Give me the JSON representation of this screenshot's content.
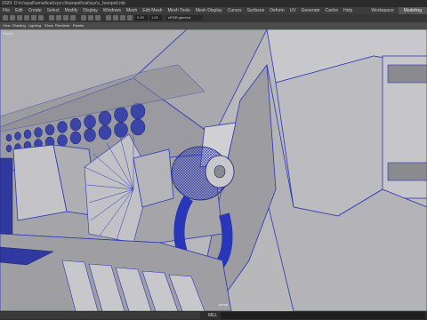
{
  "window": {
    "title": "2020: D:\\rc\\quall\\amoil\\cat\\xyz:c\\bumpoil\\cat\\xyz\\c_bumpoil.mb"
  },
  "menubar": {
    "items": [
      "File",
      "Edit",
      "Create",
      "Select",
      "Modify",
      "Display",
      "Windows",
      "Mesh",
      "Edit Mesh",
      "Mesh Tools",
      "Mesh Display",
      "Curves",
      "Surfaces",
      "Deform",
      "UV",
      "Generate",
      "Cache",
      "Help"
    ],
    "workspace_label": "Workspace:",
    "workspace_value": "Modeling"
  },
  "shelf": {
    "field_a": "0.00",
    "field_b": "1.00",
    "color_space": "sRGB gamma"
  },
  "panel_menu": {
    "items": [
      "View",
      "Shading",
      "Lighting",
      "Show",
      "Renderer",
      "Panels"
    ]
  },
  "viewport": {
    "panels_label": "Panels",
    "camera_label": "persp",
    "wire_color": "#2a36b8",
    "surface_color": "#bfbfc2"
  },
  "statusbar": {
    "mel_label": "MEL"
  }
}
